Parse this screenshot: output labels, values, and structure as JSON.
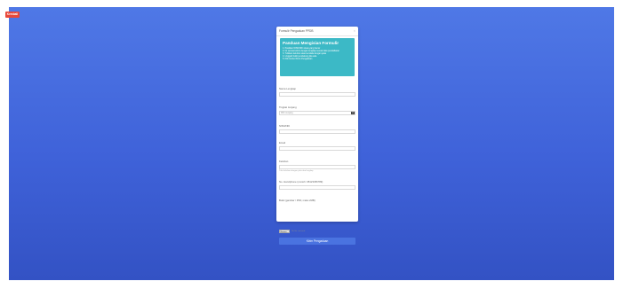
{
  "badge": "Kembali",
  "modal": {
    "title": "Formulir Pengaduan PPDB",
    "close": "×"
  },
  "guide": {
    "title": "Panduan Mengisian Formulir",
    "steps": [
      "1. Pastikan NISN/NIK siswa yang benar",
      "2. Isi semua kolom dengan lengkap sesuai data pendaftaran",
      "3. Tuliskan keluhan atau kendala dengan jelas",
      "4. Unggah bukti pendukung jika ada",
      "5. Klik tombol Kirim Pengaduan"
    ]
  },
  "fields": {
    "nama_lengkap": {
      "label": "Nama Lengkap"
    },
    "tingkat": {
      "label": "Tingkat Jenjang",
      "value": "Pilih Jenjang"
    },
    "nisn": {
      "label": "NISN/NIK"
    },
    "email": {
      "label": "Email"
    },
    "keluhan": {
      "label": "Keluhan",
      "hint": "Tulis keluhan dengan jelas dan lengkap"
    },
    "nomor_hp": {
      "label": "No. Handphone (contoh: 08123456789)"
    },
    "bukti": {
      "label": "Bukti (gambar / PDF, maks 2MB)"
    }
  },
  "file": {
    "button": "Browse...",
    "none": "No file selected."
  },
  "submit_label": "Kirim Pengaduan"
}
